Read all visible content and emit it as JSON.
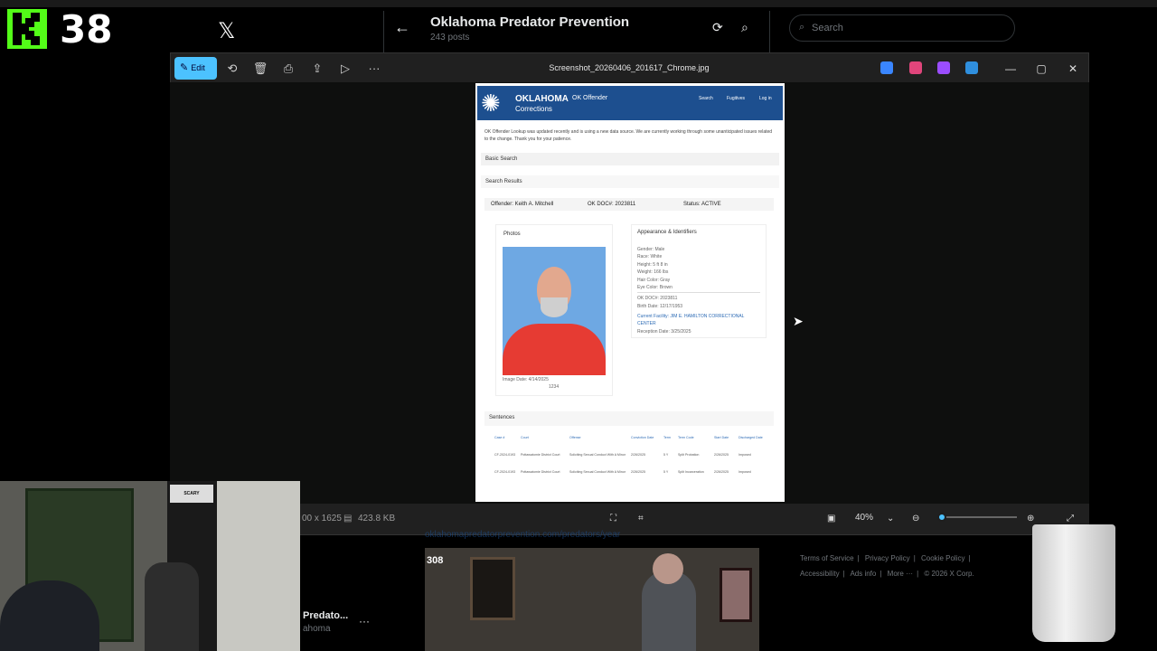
{
  "kick": {
    "count": "38"
  },
  "x_header": {
    "title": "Oklahoma Predator Prevention",
    "subtitle": "243 posts"
  },
  "search": {
    "placeholder": "Search"
  },
  "viewer": {
    "edit_label": "Edit",
    "file_name": "Screenshot_20260406_201617_Chrome.jpg",
    "dimensions": "00 x 1625",
    "file_size": "423.8 KB",
    "zoom": "40%"
  },
  "doc": {
    "brand_line1": "OKLAHOMA",
    "brand_line2": "Corrections",
    "section": "OK Offender",
    "nav": [
      "Search",
      "Fugitives",
      "Log in"
    ],
    "notice": "OK Offender Lookup was updated recently and is using a new data source. We are currently working through some unanticipated issues related to the change. Thank you for your patience.",
    "basic_search": "Basic Search",
    "search_results": "Search Results",
    "offender": "Offender: Keith A. Mitchell",
    "doc_no": "OK DOC#: 2023811",
    "status": "Status: ACTIVE",
    "photos_title": "Photos",
    "image_date": "Image Date: 4/14/2025",
    "image_num": "1234",
    "appearance_title": "Appearance & Identifiers",
    "identifiers": [
      "Gender: Male",
      "Race: White",
      "Height: 5 ft 8 in",
      "Weight: 166 lbs",
      "Hair Color: Gray",
      "Eye Color: Brown"
    ],
    "doc_line": "OK DOC#: 2023811",
    "birth": "Birth Date: 12/17/1953",
    "facility": "Current Facility: JIM E. HAMILTON CORRECTIONAL CENTER",
    "reception": "Reception Date: 3/25/2025",
    "sentences_title": "Sentences",
    "sentence_headers": [
      "Case #",
      "Court",
      "Offense",
      "Conviction Date",
      "Term",
      "Term Code",
      "Start Date",
      "Discharged Date"
    ],
    "sentence_rows": [
      [
        "CF-2024-0193",
        "Pottawatomie District Court",
        "Soliciting Sexual Conduct With A Minor",
        "2/26/2025",
        "5 Y",
        "Split Probation",
        "2/26/2025",
        "Imposed"
      ],
      [
        "CF-2024-0193",
        "Pottawatomie District Court",
        "Soliciting Sexual Conduct With A Minor",
        "2/26/2025",
        "5 Y",
        "Split Incarceration",
        "2/26/2025",
        "Imposed"
      ]
    ]
  },
  "webcam": {
    "poster": "SCARY"
  },
  "profile": {
    "name": "Predato...",
    "handle": "ahoma"
  },
  "link_ghost": "oklahomapredatorprevention.com/predators/year",
  "video": {
    "badge": "308"
  },
  "footer": {
    "links": [
      "Terms of Service",
      "|",
      "Privacy Policy",
      "|",
      "Cookie Policy",
      "|",
      "Accessibility",
      "|",
      "Ads info",
      "|",
      "More ···",
      "|",
      "© 2026 X Corp."
    ]
  }
}
